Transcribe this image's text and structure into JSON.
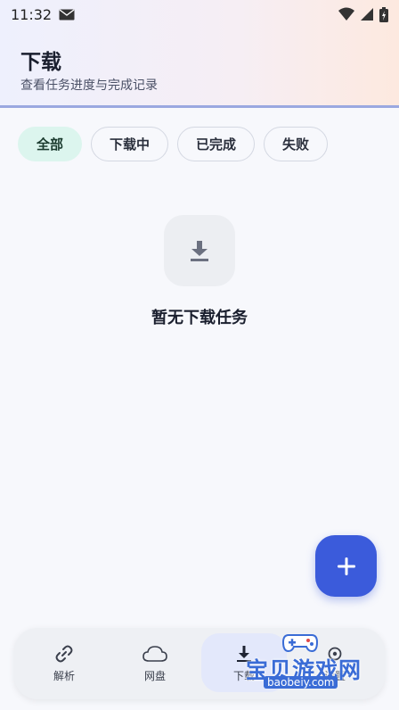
{
  "status_bar": {
    "time": "11:32"
  },
  "header": {
    "title": "下载",
    "subtitle": "查看任务进度与完成记录"
  },
  "filters": [
    "全部",
    "下载中",
    "已完成",
    "失败"
  ],
  "empty_state": {
    "icon": "download-icon",
    "text": "暂无下载任务"
  },
  "fab": {
    "icon": "plus-icon"
  },
  "bottom_nav": [
    {
      "label": "解析",
      "icon": "link-icon"
    },
    {
      "label": "网盘",
      "icon": "cloud-icon"
    },
    {
      "label": "下载",
      "icon": "download-icon",
      "active": true
    },
    {
      "label": "设置",
      "icon": "settings-icon"
    }
  ],
  "watermark": {
    "text": "宝贝游戏网",
    "url": "baobeiy.com"
  },
  "colors": {
    "accent": "#3b5bdb",
    "chip_active": "#dcf5ee",
    "nav_active": "#e3e8fb"
  }
}
